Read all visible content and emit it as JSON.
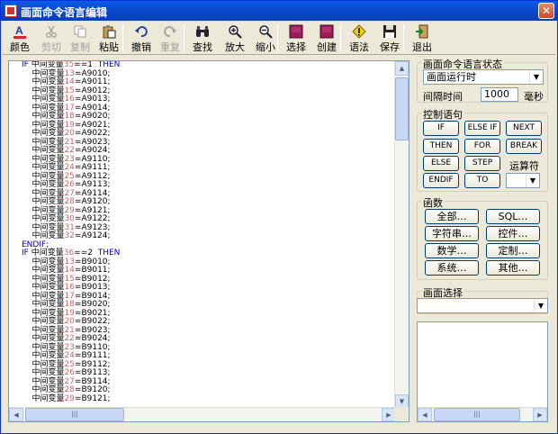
{
  "window": {
    "title": "画面命令语言编辑",
    "close_label": "✕"
  },
  "toolbar": [
    {
      "key": "color",
      "label": "颜色",
      "icon": "font-color-icon",
      "enabled": true
    },
    {
      "key": "cut",
      "label": "剪切",
      "icon": "scissors-icon",
      "enabled": false
    },
    {
      "key": "copy",
      "label": "复制",
      "icon": "copy-icon",
      "enabled": false
    },
    {
      "key": "paste",
      "label": "粘贴",
      "icon": "paste-icon",
      "enabled": true
    },
    {
      "key": "undo",
      "label": "撤销",
      "icon": "undo-icon",
      "enabled": true
    },
    {
      "key": "redo",
      "label": "重复",
      "icon": "redo-icon",
      "enabled": false
    },
    {
      "key": "find",
      "label": "查找",
      "icon": "binoculars-icon",
      "enabled": true
    },
    {
      "key": "zoom_in",
      "label": "放大",
      "icon": "zoom-in-icon",
      "enabled": true
    },
    {
      "key": "zoom_out",
      "label": "缩小",
      "icon": "zoom-out-icon",
      "enabled": true
    },
    {
      "key": "select",
      "label": "选择",
      "icon": "select-icon",
      "enabled": true
    },
    {
      "key": "create",
      "label": "创建",
      "icon": "create-icon",
      "enabled": true
    },
    {
      "key": "syntax",
      "label": "语法",
      "icon": "warning-icon",
      "enabled": true
    },
    {
      "key": "save",
      "label": "保存",
      "icon": "floppy-disk-icon",
      "enabled": true
    },
    {
      "key": "exit",
      "label": "退出",
      "icon": "exit-icon",
      "enabled": true
    }
  ],
  "code_lines": [
    [
      [
        "kw",
        "IF "
      ],
      [
        "t",
        "中间变量"
      ],
      [
        "idx",
        "35"
      ],
      [
        "t",
        "==1  "
      ],
      [
        "kw",
        "THEN"
      ]
    ],
    [
      [
        "t",
        "    中间变量"
      ],
      [
        "idx",
        "13"
      ],
      [
        "t",
        "=A9010;"
      ]
    ],
    [
      [
        "t",
        "    中间变量"
      ],
      [
        "idx",
        "14"
      ],
      [
        "t",
        "=A9011;"
      ]
    ],
    [
      [
        "t",
        "    中间变量"
      ],
      [
        "idx",
        "15"
      ],
      [
        "t",
        "=A9012;"
      ]
    ],
    [
      [
        "t",
        "    中间变量"
      ],
      [
        "idx",
        "16"
      ],
      [
        "t",
        "=A9013;"
      ]
    ],
    [
      [
        "t",
        "    中间变量"
      ],
      [
        "idx",
        "17"
      ],
      [
        "t",
        "=A9014;"
      ]
    ],
    [
      [
        "t",
        "    中间变量"
      ],
      [
        "idx",
        "18"
      ],
      [
        "t",
        "=A9020;"
      ]
    ],
    [
      [
        "t",
        "    中间变量"
      ],
      [
        "idx",
        "19"
      ],
      [
        "t",
        "=A9021;"
      ]
    ],
    [
      [
        "t",
        "    中间变量"
      ],
      [
        "idx",
        "20"
      ],
      [
        "t",
        "=A9022;"
      ]
    ],
    [
      [
        "t",
        "    中间变量"
      ],
      [
        "idx",
        "21"
      ],
      [
        "t",
        "=A9023;"
      ]
    ],
    [
      [
        "t",
        "    中间变量"
      ],
      [
        "idx",
        "22"
      ],
      [
        "t",
        "=A9024;"
      ]
    ],
    [
      [
        "t",
        "    中间变量"
      ],
      [
        "idx",
        "23"
      ],
      [
        "t",
        "=A9110;"
      ]
    ],
    [
      [
        "t",
        "    中间变量"
      ],
      [
        "idx",
        "24"
      ],
      [
        "t",
        "=A9111;"
      ]
    ],
    [
      [
        "t",
        "    中间变量"
      ],
      [
        "idx",
        "25"
      ],
      [
        "t",
        "=A9112;"
      ]
    ],
    [
      [
        "t",
        "    中间变量"
      ],
      [
        "idx",
        "26"
      ],
      [
        "t",
        "=A9113;"
      ]
    ],
    [
      [
        "t",
        "    中间变量"
      ],
      [
        "idx",
        "27"
      ],
      [
        "t",
        "=A9114;"
      ]
    ],
    [
      [
        "t",
        "    中间变量"
      ],
      [
        "idx",
        "28"
      ],
      [
        "t",
        "=A9120;"
      ]
    ],
    [
      [
        "t",
        "    中间变量"
      ],
      [
        "idx",
        "29"
      ],
      [
        "t",
        "=A9121;"
      ]
    ],
    [
      [
        "t",
        "    中间变量"
      ],
      [
        "idx",
        "30"
      ],
      [
        "t",
        "=A9122;"
      ]
    ],
    [
      [
        "t",
        "    中间变量"
      ],
      [
        "idx",
        "31"
      ],
      [
        "t",
        "=A9123;"
      ]
    ],
    [
      [
        "t",
        "    中间变量"
      ],
      [
        "idx",
        "32"
      ],
      [
        "t",
        "=A9124;"
      ]
    ],
    [
      [
        "kw",
        "ENDIF"
      ],
      [
        "t",
        ";"
      ]
    ],
    [
      [
        "t",
        ""
      ]
    ],
    [
      [
        "kw",
        "IF "
      ],
      [
        "t",
        "中间变量"
      ],
      [
        "idx",
        "36"
      ],
      [
        "t",
        "==2  "
      ],
      [
        "kw",
        "THEN"
      ]
    ],
    [
      [
        "t",
        "    中间变量"
      ],
      [
        "idx",
        "13"
      ],
      [
        "t",
        "=B9010;"
      ]
    ],
    [
      [
        "t",
        "    中间变量"
      ],
      [
        "idx",
        "14"
      ],
      [
        "t",
        "=B9011;"
      ]
    ],
    [
      [
        "t",
        "    中间变量"
      ],
      [
        "idx",
        "15"
      ],
      [
        "t",
        "=B9012;"
      ]
    ],
    [
      [
        "t",
        "    中间变量"
      ],
      [
        "idx",
        "16"
      ],
      [
        "t",
        "=B9013;"
      ]
    ],
    [
      [
        "t",
        "    中间变量"
      ],
      [
        "idx",
        "17"
      ],
      [
        "t",
        "=B9014;"
      ]
    ],
    [
      [
        "t",
        "    中间变量"
      ],
      [
        "idx",
        "18"
      ],
      [
        "t",
        "=B9020;"
      ]
    ],
    [
      [
        "t",
        "    中间变量"
      ],
      [
        "idx",
        "19"
      ],
      [
        "t",
        "=B9021;"
      ]
    ],
    [
      [
        "t",
        "    中间变量"
      ],
      [
        "idx",
        "20"
      ],
      [
        "t",
        "=B9022;"
      ]
    ],
    [
      [
        "t",
        "    中间变量"
      ],
      [
        "idx",
        "21"
      ],
      [
        "t",
        "=B9023;"
      ]
    ],
    [
      [
        "t",
        "    中间变量"
      ],
      [
        "idx",
        "22"
      ],
      [
        "t",
        "=B9024;"
      ]
    ],
    [
      [
        "t",
        "    中间变量"
      ],
      [
        "idx",
        "23"
      ],
      [
        "t",
        "=B9110;"
      ]
    ],
    [
      [
        "t",
        "    中间变量"
      ],
      [
        "idx",
        "24"
      ],
      [
        "t",
        "=B9111;"
      ]
    ],
    [
      [
        "t",
        "    中间变量"
      ],
      [
        "idx",
        "25"
      ],
      [
        "t",
        "=B9112;"
      ]
    ],
    [
      [
        "t",
        "    中间变量"
      ],
      [
        "idx",
        "26"
      ],
      [
        "t",
        "=B9113;"
      ]
    ],
    [
      [
        "t",
        "    中间变量"
      ],
      [
        "idx",
        "27"
      ],
      [
        "t",
        "=B9114;"
      ]
    ],
    [
      [
        "t",
        "    中间变量"
      ],
      [
        "idx",
        "28"
      ],
      [
        "t",
        "=B9120;"
      ]
    ],
    [
      [
        "t",
        "    中间变量"
      ],
      [
        "idx",
        "29"
      ],
      [
        "t",
        "=B9121;"
      ]
    ]
  ],
  "state_group": {
    "legend": "画面命令语言状态",
    "state_value": "画面运行时",
    "interval_label": "间隔时间",
    "interval_value": "1000",
    "unit_label": "毫秒"
  },
  "control_group": {
    "legend": "控制语句",
    "buttons": [
      "IF",
      "ELSE IF",
      "NEXT",
      "THEN",
      "FOR",
      "BREAK",
      "ELSE",
      "STEP",
      "ENDIF",
      "TO"
    ],
    "operator_label": "运算符",
    "operator_value": ""
  },
  "function_group": {
    "legend": "函数",
    "buttons": [
      "全部…",
      "SQL…",
      "字符串…",
      "控件…",
      "数学…",
      "定制…",
      "系统…",
      "其他…"
    ]
  },
  "screen_group": {
    "legend": "画面选择",
    "value": ""
  }
}
